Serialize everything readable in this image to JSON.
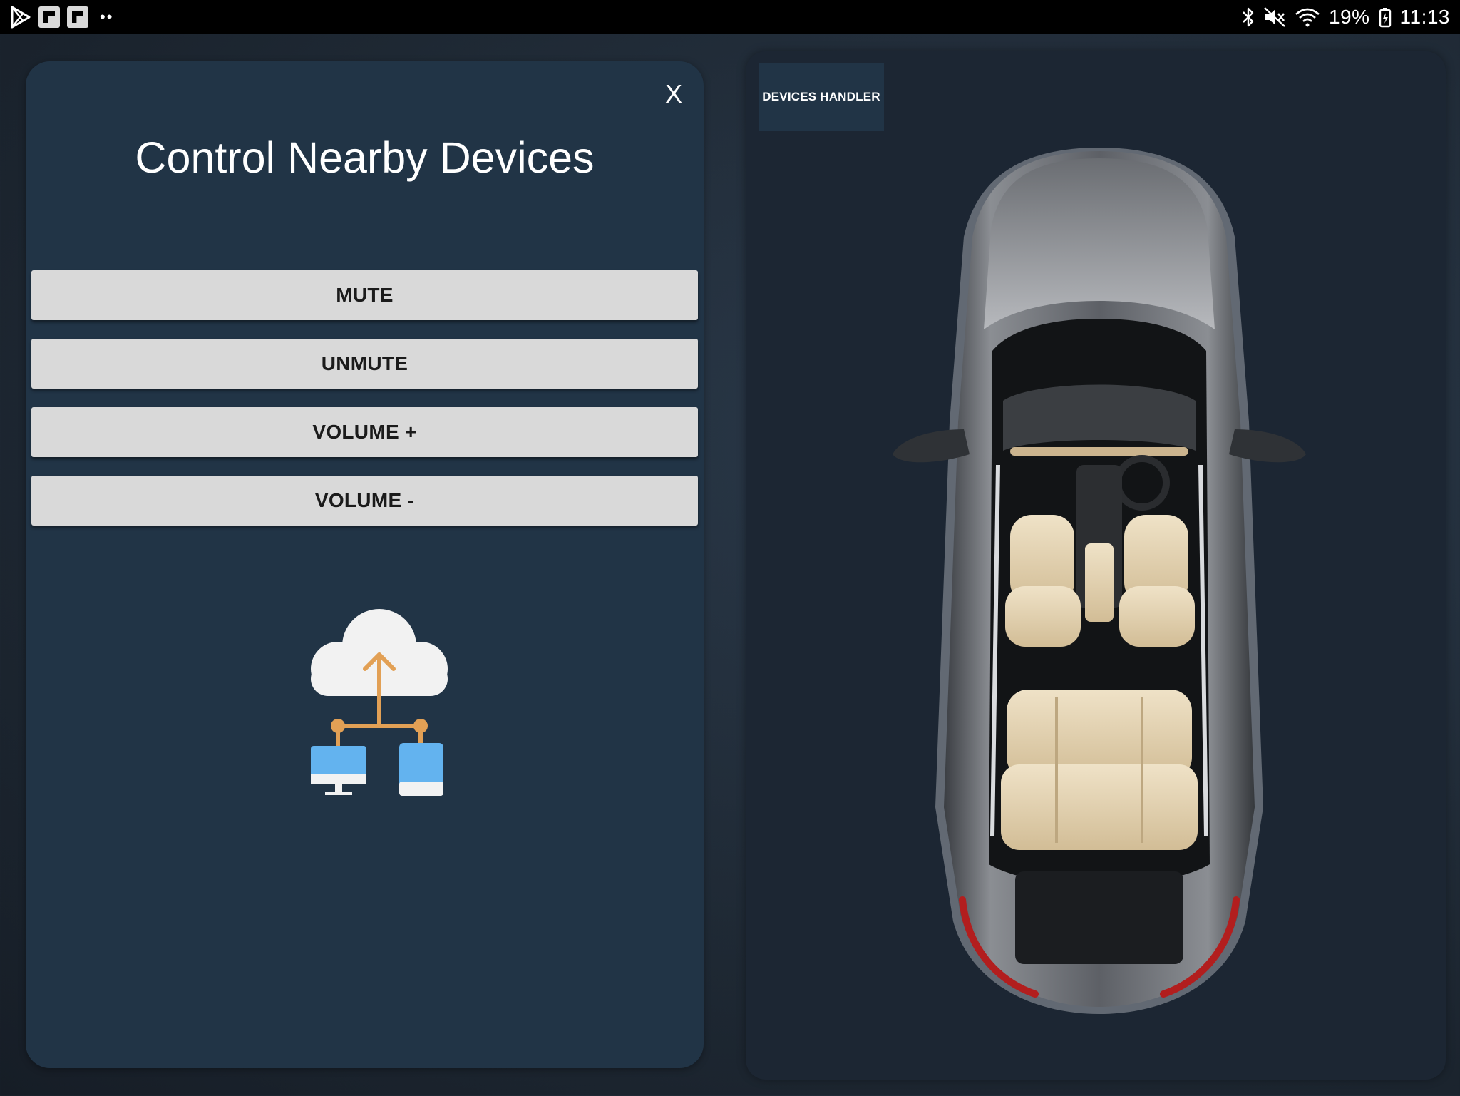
{
  "status_bar": {
    "left_icons": [
      "play-store-icon",
      "flipboard-icon",
      "flipboard-icon",
      "more-dots-icon"
    ],
    "right_icons": [
      "bluetooth-icon",
      "mute-icon",
      "wifi-icon",
      "battery-icon"
    ],
    "battery": "19%",
    "time": "11:13"
  },
  "panel": {
    "close_label": "X",
    "title": "Control Nearby Devices",
    "buttons": {
      "mute": "MUTE",
      "unmute": "UNMUTE",
      "volume_up": "VOLUME +",
      "volume_down": "VOLUME -"
    },
    "illustration": "cloud-devices-icon"
  },
  "right": {
    "devices_handler_label": "DEVICES HANDLER",
    "image": "car-top-view"
  },
  "colors": {
    "panel_bg": "#213446",
    "button_bg": "#d9d9d9",
    "accent_orange": "#e9a04f",
    "device_blue": "#63b3ef"
  }
}
